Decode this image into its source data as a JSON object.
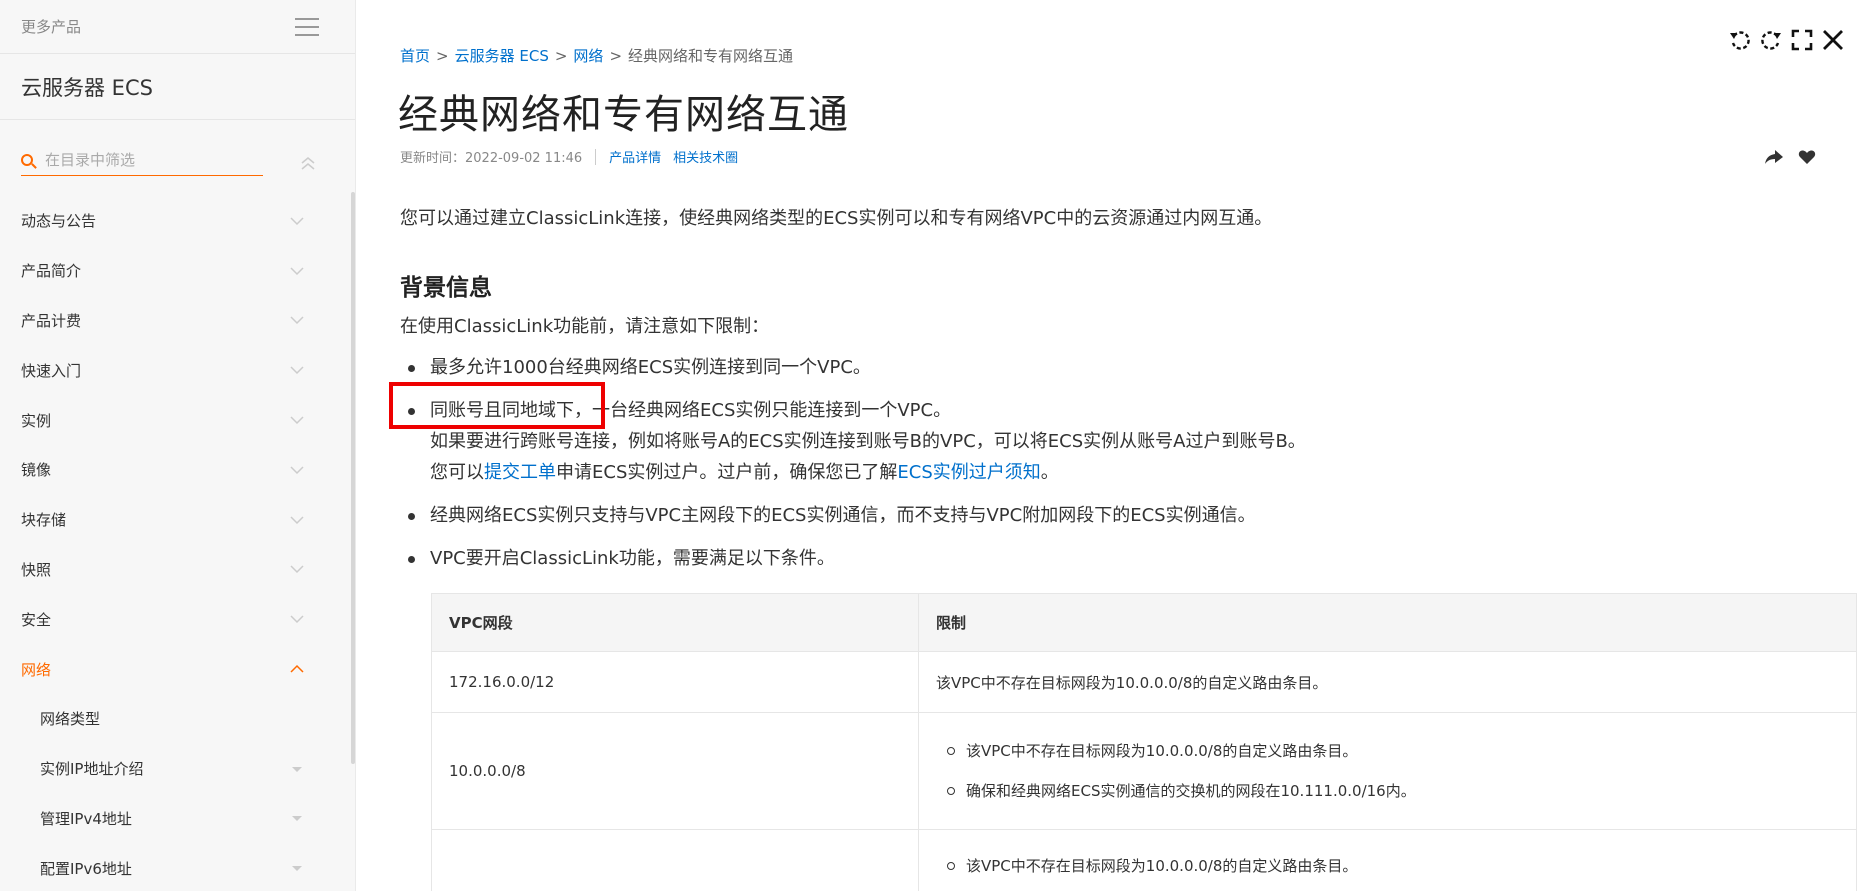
{
  "sidebar": {
    "more_products": "更多产品",
    "product_title": "云服务器 ECS",
    "search_placeholder": "在目录中筛选",
    "items": [
      {
        "label": "动态与公告"
      },
      {
        "label": "产品简介"
      },
      {
        "label": "产品计费"
      },
      {
        "label": "快速入门"
      },
      {
        "label": "实例"
      },
      {
        "label": "镜像"
      },
      {
        "label": "块存储"
      },
      {
        "label": "快照"
      },
      {
        "label": "安全"
      },
      {
        "label": "网络",
        "active": true
      }
    ],
    "sub_items": [
      {
        "label": "网络类型"
      },
      {
        "label": "实例IP地址介绍"
      },
      {
        "label": "管理IPv4地址"
      },
      {
        "label": "配置IPv6地址"
      }
    ]
  },
  "breadcrumb": {
    "home": "首页",
    "product": "云服务器 ECS",
    "section": "网络",
    "current": "经典网络和专有网络互通",
    "separator": ">"
  },
  "article": {
    "title": "经典网络和专有网络互通",
    "updated": "更新时间：2022-09-02 11:46",
    "link_product_detail": "产品详情",
    "link_tech_circle": "相关技术圈",
    "intro": "您可以通过建立ClassicLink连接，使经典网络类型的ECS实例可以和专有网络VPC中的云资源通过内网互通。",
    "section_heading": "背景信息",
    "pre_text": "在使用ClassicLink功能前，请注意如下限制：",
    "bullet1": "最多允许1000台经典网络ECS实例连接到同一个VPC。",
    "bullet2_line1": "同账号且同地域下，一台经典网络ECS实例只能连接到一个VPC。",
    "bullet2_line2": "如果要进行跨账号连接，例如将账号A的ECS实例连接到账号B的VPC，可以将ECS实例从账号A过户到账号B。",
    "bullet2_line3_pre": "您可以",
    "bullet2_link1": "提交工单",
    "bullet2_line3_mid": "申请ECS实例过户。过户前，确保您已了解",
    "bullet2_link2": "ECS实例过户须知",
    "bullet2_line3_end": "。",
    "bullet3": "经典网络ECS实例只支持与VPC主网段下的ECS实例通信，而不支持与VPC附加网段下的ECS实例通信。",
    "bullet4": "VPC要开启ClassicLink功能，需要满足以下条件。"
  },
  "table": {
    "headers": [
      "VPC网段",
      "限制"
    ],
    "rows": [
      {
        "segment": "172.16.0.0/12",
        "limits": [
          "该VPC中不存在目标网段为10.0.0.0/8的自定义路由条目。"
        ]
      },
      {
        "segment": "10.0.0.0/8",
        "limits": [
          "该VPC中不存在目标网段为10.0.0.0/8的自定义路由条目。",
          "确保和经典网络ECS实例通信的交换机的网段在10.111.0.0/16内。"
        ]
      },
      {
        "segment": "",
        "limits": [
          "该VPC中不存在目标网段为10.0.0.0/8的自定义路由条目。"
        ]
      }
    ]
  },
  "toolbar": {
    "icons": [
      "rotate-left-icon",
      "rotate-right-icon",
      "fullscreen-icon",
      "close-icon"
    ]
  },
  "colors": {
    "accent": "#ff6a00",
    "link": "#0070cc",
    "highlight": "#ee0000"
  }
}
